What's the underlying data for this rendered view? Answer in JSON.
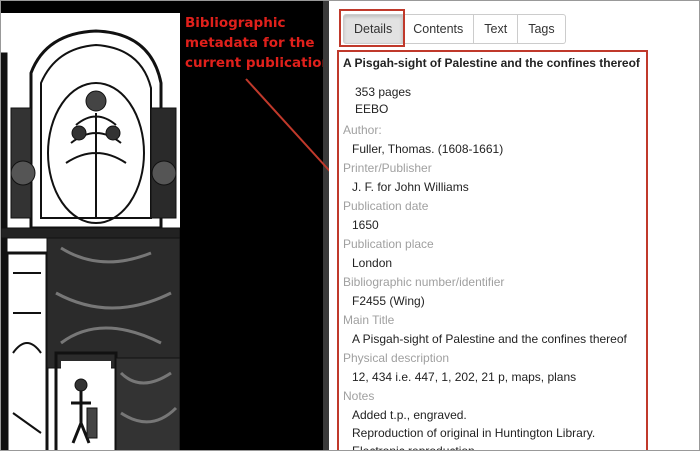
{
  "annotation": {
    "lines": [
      "Bibliographic",
      "metadata for the",
      "current publication"
    ]
  },
  "tabs": [
    {
      "label": "Details",
      "active": true
    },
    {
      "label": "Contents",
      "active": false
    },
    {
      "label": "Text",
      "active": false
    },
    {
      "label": "Tags",
      "active": false
    }
  ],
  "details": {
    "title": "A Pisgah-sight of Palestine and the confines thereof",
    "pages": "353 pages",
    "collection": "EEBO",
    "fields": [
      {
        "label": "Author:",
        "values": [
          "Fuller, Thomas. (1608-1661)"
        ]
      },
      {
        "label": "Printer/Publisher",
        "values": [
          "J. F. for John Williams"
        ]
      },
      {
        "label": "Publication date",
        "values": [
          "1650"
        ]
      },
      {
        "label": "Publication place",
        "values": [
          "London"
        ]
      },
      {
        "label": "Bibliographic number/identifier",
        "values": [
          "F2455 (Wing)"
        ]
      },
      {
        "label": "Main Title",
        "values": [
          "A Pisgah-sight of Palestine and the confines thereof"
        ]
      },
      {
        "label": "Physical description",
        "values": [
          "12, 434 i.e. 447, 1, 202, 21 p, maps, plans"
        ]
      },
      {
        "label": "Notes",
        "values": [
          "Added t.p., engraved.",
          "Reproduction of original in Huntington Library.",
          "Electronic reproduction."
        ]
      }
    ]
  },
  "colors": {
    "highlight": "#c0392b",
    "annotation_text": "#e0201b",
    "label_gray": "#a0a0a0"
  }
}
